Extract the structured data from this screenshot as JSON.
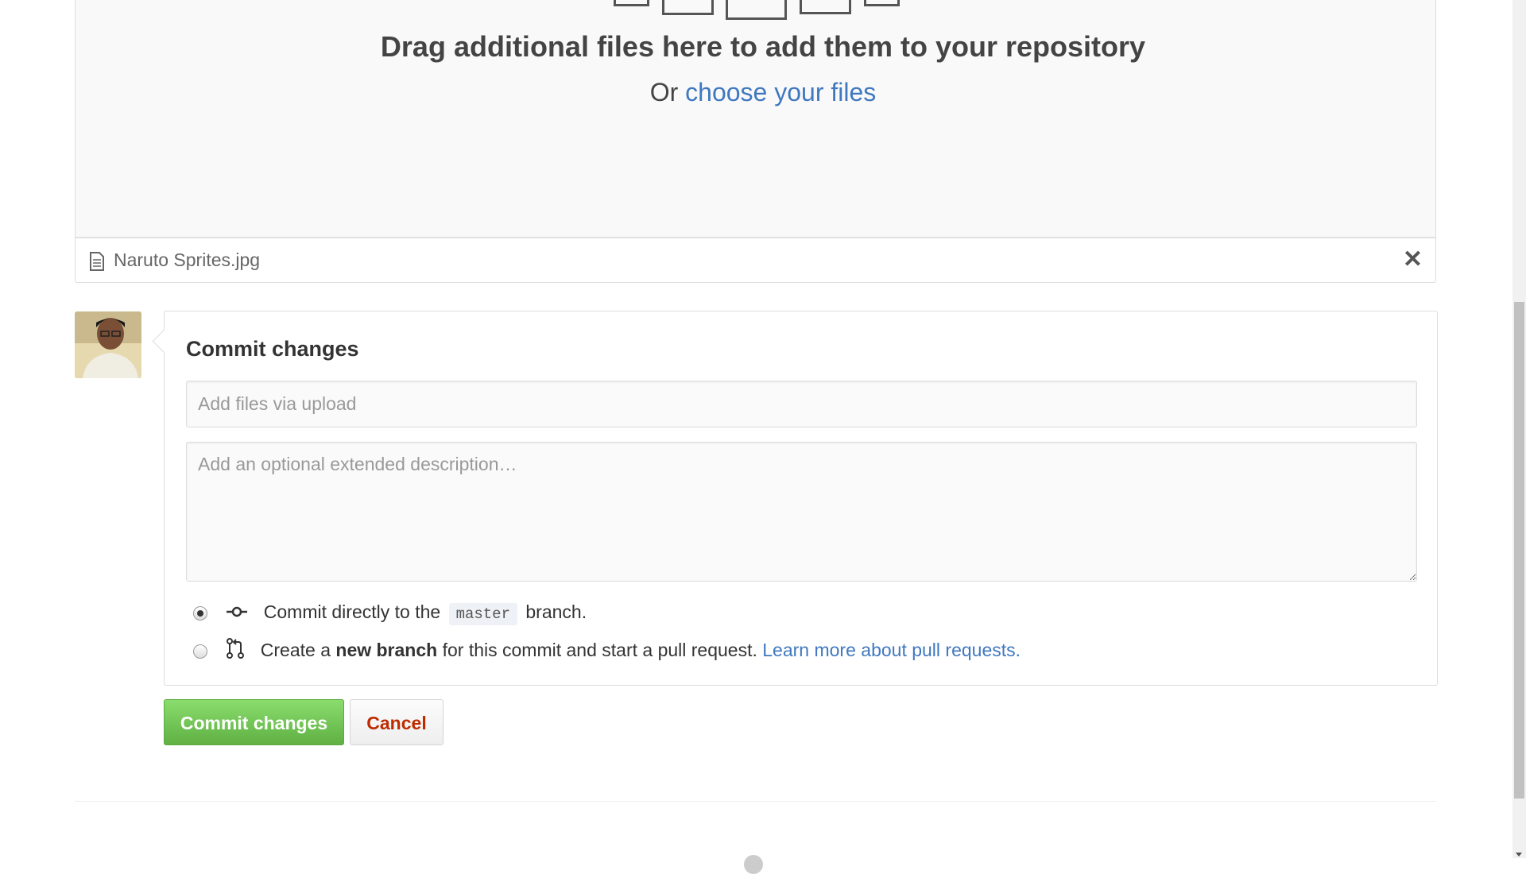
{
  "dropzone": {
    "title": "Drag additional files here to add them to your repository",
    "prefix": "Or",
    "choose_link": "choose your files"
  },
  "upload": {
    "file_name": "Naruto Sprites.jpg",
    "remove_glyph": "✕"
  },
  "commit": {
    "heading": "Commit changes",
    "summary_placeholder": "Add files via upload",
    "description_placeholder": "Add an optional extended description…",
    "option_direct": {
      "before": "Commit directly to the",
      "branch": "master",
      "after": "branch."
    },
    "option_new_branch": {
      "before": "Create a",
      "bold": "new branch",
      "after": "for this commit and start a pull request.",
      "link": "Learn more about pull requests."
    },
    "selected_option": "direct"
  },
  "buttons": {
    "commit_label": "Commit changes",
    "cancel_label": "Cancel"
  },
  "colors": {
    "link": "#4078c0",
    "primary_button": "#60b044",
    "cancel_text": "#bd2c00"
  },
  "icons": [
    "file-icon",
    "close-icon",
    "git-commit-icon",
    "git-pull-request-icon",
    "avatar-image",
    "github-logo-icon"
  ]
}
